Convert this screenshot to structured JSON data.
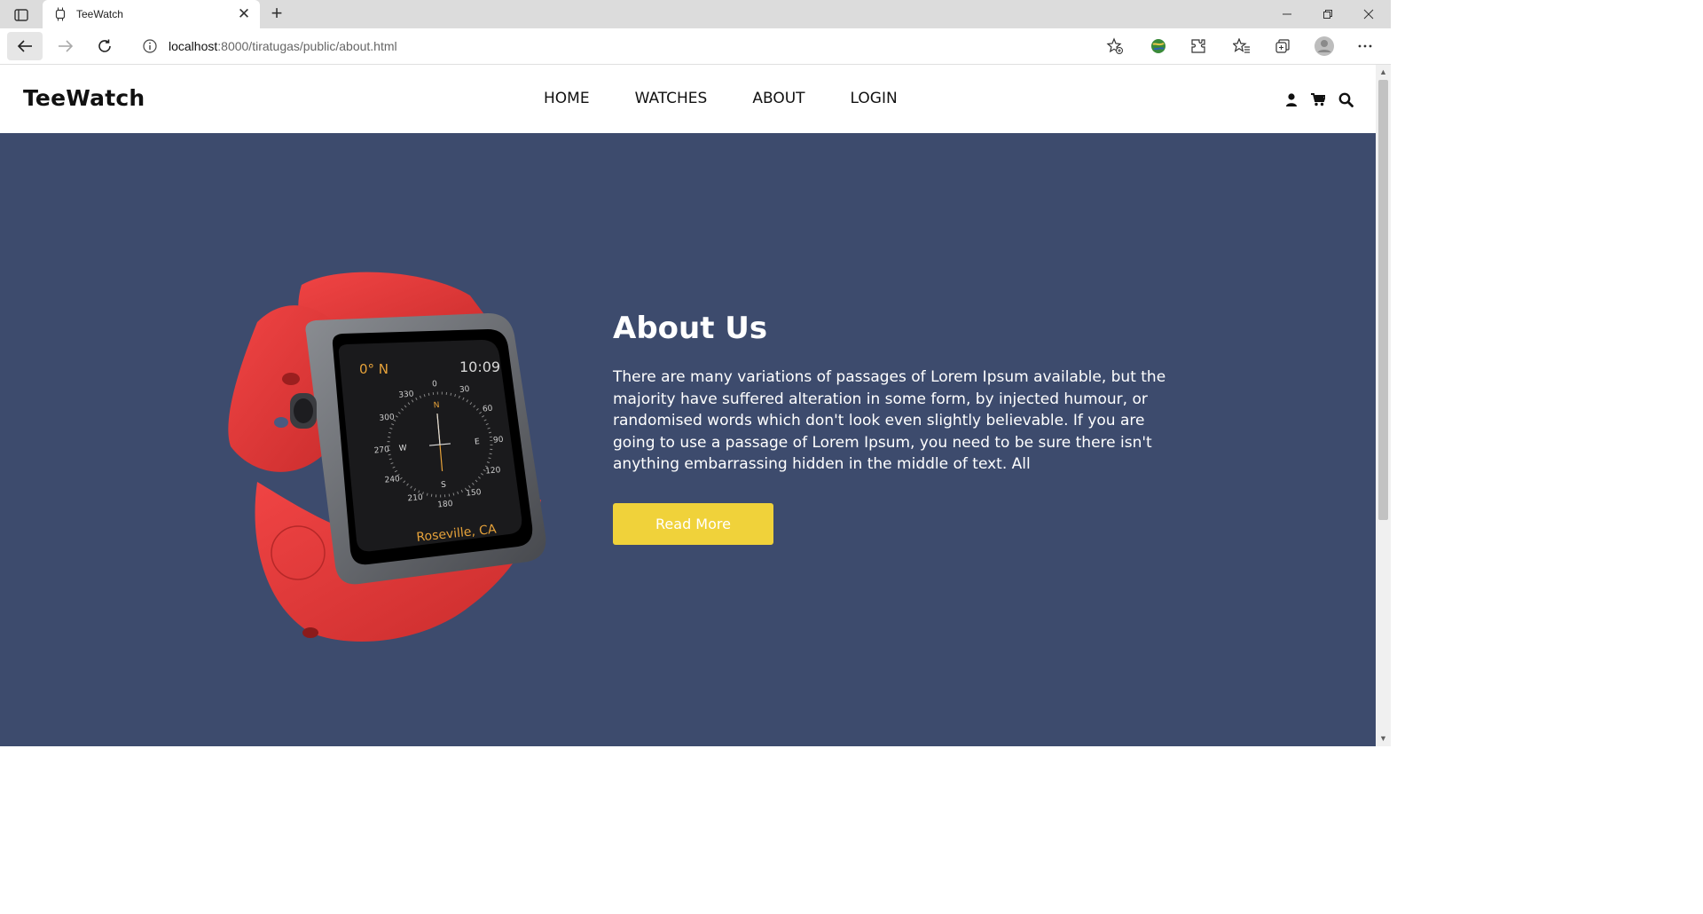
{
  "browser": {
    "tab_title": "TeeWatch",
    "url_host": "localhost",
    "url_rest": ":8000/tiratugas/public/about.html"
  },
  "site": {
    "logo": "TeeWatch",
    "menu": [
      "HOME",
      "WATCHES",
      "ABOUT",
      "LOGIN"
    ],
    "icons": [
      "user-icon",
      "cart-icon",
      "search-icon"
    ]
  },
  "about": {
    "title": "About Us",
    "text": "There are many variations of passages of Lorem Ipsum available, but the majority have suffered alteration in some form, by injected humour, or randomised words which don't look even slightly believable. If you are going to use a passage of Lorem Ipsum, you need to be sure there isn't anything embarrassing hidden in the middle of text. All",
    "button": "Read More"
  },
  "watch_face": {
    "heading": "0° N",
    "time": "10:09",
    "location": "Roseville, CA",
    "compass_numbers": [
      "0",
      "30",
      "60",
      "90",
      "120",
      "150",
      "180",
      "210",
      "240",
      "270",
      "300",
      "330"
    ],
    "compass_letters": [
      "N",
      "E",
      "S",
      "W"
    ]
  },
  "colors": {
    "page_bg": "#3d4b6d",
    "button": "#f0d23a",
    "band": "#e23a3a"
  }
}
